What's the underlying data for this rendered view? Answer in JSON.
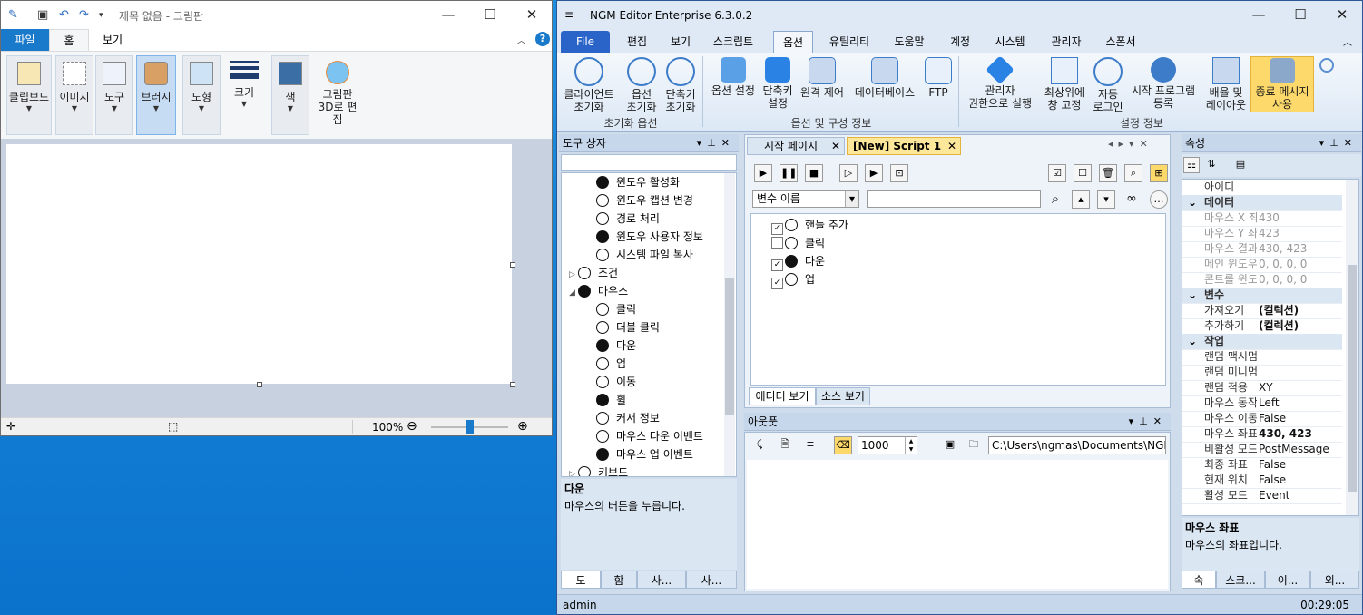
{
  "paint": {
    "title": "제목 없음 - 그림판",
    "tabs": [
      "파일",
      "홈",
      "보기"
    ],
    "tools": [
      {
        "label": "클립보드",
        "icon": "clipboard-icon"
      },
      {
        "label": "이미지",
        "icon": "image-select-icon"
      },
      {
        "label": "도구",
        "icon": "tools-icon"
      },
      {
        "label": "브러시",
        "icon": "brush-icon"
      },
      {
        "label": "도형",
        "icon": "shapes-icon"
      },
      {
        "label": "크기",
        "icon": "line-size-icon"
      },
      {
        "label": "색",
        "icon": "color-icon"
      },
      {
        "label": "그림판 3D로 편집",
        "icon": "paint3d-icon"
      }
    ],
    "zoom": "100%"
  },
  "ngm": {
    "title": "NGM Editor  Enterprise 6.3.0.2",
    "menu": [
      "File",
      "편집",
      "보기",
      "스크립트",
      "옵션",
      "유틸리티",
      "도움말",
      "계정",
      "시스템",
      "관리자",
      "스폰서"
    ],
    "ribbon_buttons": [
      {
        "label": "클라이언트\n초기화"
      },
      {
        "label": "옵션\n초기화"
      },
      {
        "label": "단축키\n초기화"
      },
      {
        "label": "옵션 설정"
      },
      {
        "label": "단축키\n설정"
      },
      {
        "label": "원격 제어"
      },
      {
        "label": "데이터베이스"
      },
      {
        "label": "FTP"
      },
      {
        "label": "관리자\n권한으로 실행"
      },
      {
        "label": "최상위에\n창 고정"
      },
      {
        "label": "자동\n로그인"
      },
      {
        "label": "시작 프로그램\n등록"
      },
      {
        "label": "배율 및\n레이아웃"
      },
      {
        "label": "종료 메시지\n사용"
      }
    ],
    "ribbon_groups": [
      "초기화 옵션",
      "옵션 및 구성 정보",
      "설정 정보"
    ],
    "toolbox": {
      "title": "도구 상자",
      "items": [
        {
          "label": "윈도우 활성화",
          "indent": 2
        },
        {
          "label": "윈도우 캡션 변경",
          "indent": 2
        },
        {
          "label": "경로 처리",
          "indent": 2
        },
        {
          "label": "윈도우 사용자 정보",
          "indent": 2
        },
        {
          "label": "시스템 파일 복사",
          "indent": 2
        },
        {
          "label": "조건",
          "indent": 1,
          "exp": "▷"
        },
        {
          "label": "마우스",
          "indent": 1,
          "exp": "◢"
        },
        {
          "label": "클릭",
          "indent": 2
        },
        {
          "label": "더블 클릭",
          "indent": 2
        },
        {
          "label": "다운",
          "indent": 2
        },
        {
          "label": "업",
          "indent": 2
        },
        {
          "label": "이동",
          "indent": 2
        },
        {
          "label": "휠",
          "indent": 2
        },
        {
          "label": "커서 정보",
          "indent": 2
        },
        {
          "label": "마우스 다운 이벤트",
          "indent": 2
        },
        {
          "label": "마우스 업 이벤트",
          "indent": 2
        },
        {
          "label": "키보드",
          "indent": 1,
          "exp": "▷"
        }
      ],
      "desc_title": "다운",
      "desc_text": "마우스의 버튼을 누릅니다.",
      "tabs": [
        "도",
        "함",
        "사...",
        "사..."
      ]
    },
    "editor": {
      "tabs": [
        "시작 페이지",
        "[New] Script 1"
      ],
      "variable_select": "변수 이름",
      "search_value": "",
      "script_items": [
        {
          "label": "핸들 추가",
          "checked": true
        },
        {
          "label": "클릭",
          "checked": false
        },
        {
          "label": "다운",
          "checked": true
        },
        {
          "label": "업",
          "checked": true
        }
      ],
      "bottom_tabs": [
        "에디터 보기",
        "소스 보기"
      ]
    },
    "output": {
      "title": "아웃풋",
      "count": "1000",
      "path": "C:\\Users\\ngmas\\Documents\\NGM6\\"
    },
    "properties": {
      "title": "속성",
      "rows": [
        {
          "k": "아이디",
          "v": "",
          "type": "row"
        },
        {
          "k": "데이터",
          "v": "",
          "type": "cat"
        },
        {
          "k": "마우스 X 좌표",
          "v": "430",
          "type": "dim"
        },
        {
          "k": "마우스 Y 좌표",
          "v": "423",
          "type": "dim"
        },
        {
          "k": "마우스 결과",
          "v": "430, 423",
          "type": "dim"
        },
        {
          "k": "메인 윈도우",
          "v": "0, 0, 0, 0",
          "type": "dim"
        },
        {
          "k": "콘트롤 윈도우",
          "v": "0, 0, 0, 0",
          "type": "dim"
        },
        {
          "k": "변수",
          "v": "",
          "type": "cat"
        },
        {
          "k": "가져오기",
          "v": "(컬렉션)",
          "type": "bold"
        },
        {
          "k": "추가하기",
          "v": "(컬렉션)",
          "type": "bold"
        },
        {
          "k": "작업",
          "v": "",
          "type": "cat"
        },
        {
          "k": "랜덤 맥시멈",
          "v": "",
          "type": "row"
        },
        {
          "k": "랜덤 미니멈",
          "v": "",
          "type": "row"
        },
        {
          "k": "랜덤 적용",
          "v": "XY",
          "type": "row"
        },
        {
          "k": "마우스 동작",
          "v": "Left",
          "type": "row"
        },
        {
          "k": "마우스 이동",
          "v": "False",
          "type": "row"
        },
        {
          "k": "마우스 좌표",
          "v": "430, 423",
          "type": "bold"
        },
        {
          "k": "비활성 모드",
          "v": "PostMessage",
          "type": "row"
        },
        {
          "k": "최종 좌표",
          "v": "False",
          "type": "row"
        },
        {
          "k": "현재 위치",
          "v": "False",
          "type": "row"
        },
        {
          "k": "활성 모드",
          "v": "Event",
          "type": "row"
        }
      ],
      "desc_title": "마우스 좌표",
      "desc_text": "마우스의 좌표입니다.",
      "tabs": [
        "속",
        "스크...",
        "이...",
        "외..."
      ]
    },
    "status": {
      "user": "admin",
      "time": "00:29:05"
    }
  }
}
